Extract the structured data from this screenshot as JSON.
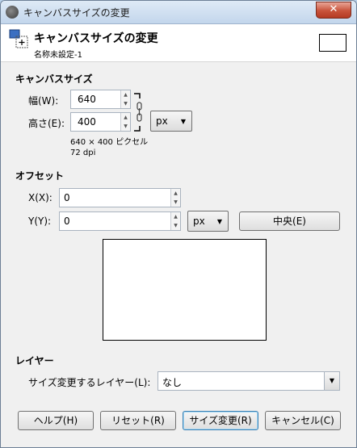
{
  "window": {
    "title": "キャンバスサイズの変更",
    "close_glyph": "✕"
  },
  "header": {
    "title": "キャンバスサイズの変更",
    "subtitle": "名称未設定-1"
  },
  "canvas_size": {
    "section_label": "キャンバスサイズ",
    "width_label": "幅(W):",
    "width_value": "640",
    "height_label": "高さ(E):",
    "height_value": "400",
    "unit": "px",
    "size_info": "640 × 400 ピクセル",
    "dpi_info": "72 dpi"
  },
  "offset": {
    "section_label": "オフセット",
    "x_label": "X(X):",
    "x_value": "0",
    "y_label": "Y(Y):",
    "y_value": "0",
    "unit": "px",
    "center_button": "中央(E)"
  },
  "layers": {
    "section_label": "レイヤー",
    "resize_label": "サイズ変更するレイヤー(L):",
    "resize_value": "なし"
  },
  "buttons": {
    "help": "ヘルプ(H)",
    "reset": "リセット(R)",
    "resize": "サイズ変更(R)",
    "cancel": "キャンセル(C)"
  },
  "icons": {
    "app": "gimp-icon",
    "header": "canvas-size-icon",
    "chain": "chain-link-icon"
  }
}
